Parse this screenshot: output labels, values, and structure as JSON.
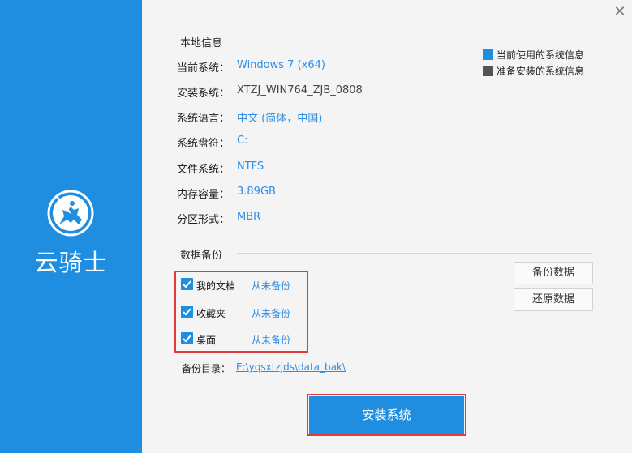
{
  "brand": {
    "name": "云骑士",
    "color": "#1f8ee0"
  },
  "window": {
    "close_icon": "close-icon"
  },
  "local_info": {
    "title": "本地信息",
    "rows": [
      {
        "label": "当前系统：",
        "value": "Windows 7 (x64)",
        "color": "blue"
      },
      {
        "label": "安装系统：",
        "value": "XTZJ_WIN764_ZJB_0808",
        "color": "gray"
      },
      {
        "label": "系统语言：",
        "value": "中文 (简体，中国)",
        "color": "blue"
      },
      {
        "label": "系统盘符：",
        "value": "C:",
        "color": "blue"
      },
      {
        "label": "文件系统：",
        "value": "NTFS",
        "color": "blue"
      },
      {
        "label": "内存容量：",
        "value": "3.89GB",
        "color": "blue"
      },
      {
        "label": "分区形式：",
        "value": "MBR",
        "color": "blue"
      }
    ]
  },
  "legend": {
    "current": {
      "label": "当前使用的系统信息",
      "color": "#1f8ee0"
    },
    "install": {
      "label": "准备安装的系统信息",
      "color": "#555555"
    }
  },
  "backup": {
    "title": "数据备份",
    "items": [
      {
        "label": "我的文档",
        "status": "从未备份",
        "checked": true
      },
      {
        "label": "收藏夹",
        "status": "从未备份",
        "checked": true
      },
      {
        "label": "桌面",
        "status": "从未备份",
        "checked": true
      }
    ],
    "backup_button": "备份数据",
    "restore_button": "还原数据",
    "dir_label": "备份目录：",
    "dir_value": "E:\\yqsxtzjds\\data_bak\\"
  },
  "install_button": "安装系统",
  "highlight_color": "#e03c3c"
}
